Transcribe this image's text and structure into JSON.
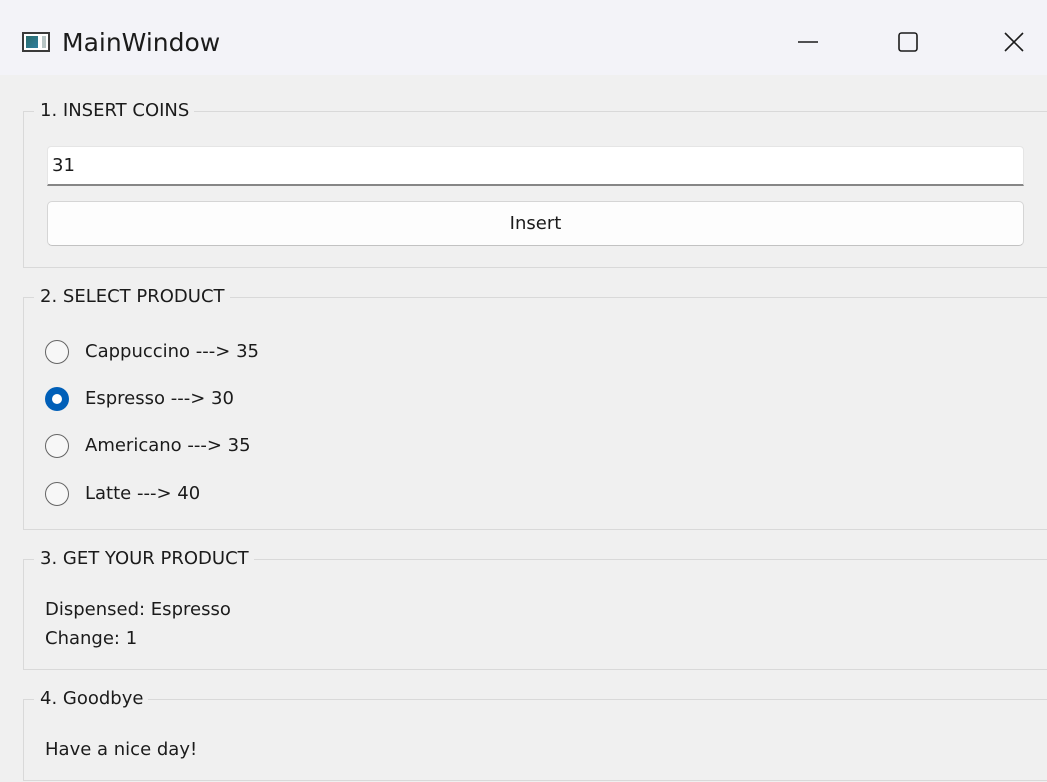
{
  "window": {
    "title": "MainWindow"
  },
  "insert_coins": {
    "title": "1. INSERT COINS",
    "input_value": "31",
    "button_label": "Insert"
  },
  "select_product": {
    "title": "2. SELECT PRODUCT",
    "options": [
      {
        "label": "Cappuccino ---> 35",
        "checked": false
      },
      {
        "label": "Espresso ---> 30",
        "checked": true
      },
      {
        "label": "Americano ---> 35",
        "checked": false
      },
      {
        "label": "Latte ---> 40",
        "checked": false
      }
    ]
  },
  "get_product": {
    "title": "3. GET YOUR PRODUCT",
    "dispensed": "Dispensed: Espresso",
    "change": "Change: 1"
  },
  "goodbye": {
    "title": "4. Goodbye",
    "message": "Have a nice day!"
  },
  "colors": {
    "accent": "#005fb8",
    "window_bg": "#f0f0f0",
    "titlebar_bg": "#f3f3f8"
  },
  "icons": {
    "app": "app-window-icon",
    "minimize": "minimize-icon",
    "maximize": "maximize-icon",
    "close": "close-icon"
  }
}
